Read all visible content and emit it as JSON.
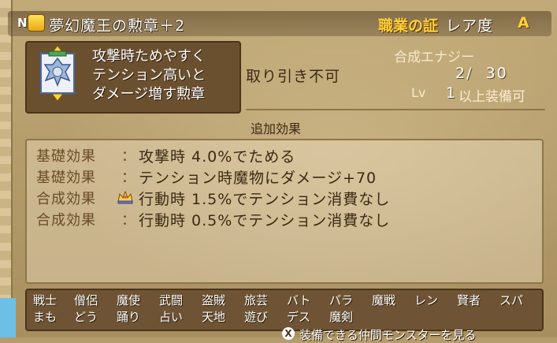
{
  "header": {
    "rank": "N",
    "icon": "coin-bag-icon",
    "title": "夢幻魔王の勲章＋2",
    "cert_label": "職業の証",
    "rarity_label": "レア度",
    "rarity_value": "A"
  },
  "item": {
    "icon": "medal-icon",
    "desc_lines": [
      "攻撃時ためやすく",
      "テンション高いと",
      "ダメージ増す勲章"
    ],
    "trade": "取り引き不可",
    "synth_label": "合成エナジー",
    "synth_value": "2/  30",
    "lv_label": "Lv",
    "lv_value": "1",
    "lv_suffix": "以上装備可"
  },
  "extra": {
    "title": "追加効果",
    "effects": [
      {
        "category": "基礎効果",
        "colon": "：",
        "text": "攻撃時 4.0%でためる"
      },
      {
        "category": "基礎効果",
        "colon": "：",
        "text": "テンション時魔物にダメージ+70"
      },
      {
        "category": "合成効果",
        "colon": "",
        "text": "行動時 1.5%でテンション消費なし",
        "icon": "crown-icon"
      },
      {
        "category": "合成効果",
        "colon": "：",
        "text": "行動時 0.5%でテンション消費なし"
      }
    ]
  },
  "jobs": {
    "row1": [
      "戦士",
      "僧侶",
      "魔使",
      "武闘",
      "盗賊",
      "旅芸",
      "バト",
      "パラ",
      "魔戦",
      "レン",
      "賢者",
      "スパ"
    ],
    "row2": [
      "まも",
      "どう",
      "踊り",
      "占い",
      "天地",
      "遊び",
      "デス",
      "魔剣"
    ]
  },
  "hint": {
    "button": "X",
    "text": "装備できる仲間モンスターを見る"
  },
  "colors": {
    "gold": "#ffd23a",
    "panel": "#6b5030",
    "parchment": "#b49c6c"
  }
}
